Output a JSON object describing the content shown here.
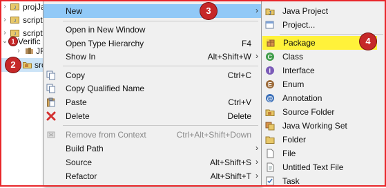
{
  "tree": {
    "rows": [
      {
        "label": "projJa",
        "chevron": "›"
      },
      {
        "label": "script",
        "chevron": "›"
      },
      {
        "label": "script",
        "chevron": "›"
      },
      {
        "label": "Verific",
        "chevron": "⌄"
      },
      {
        "label": "JR",
        "chevron": "›"
      },
      {
        "label": "src",
        "chevron": ""
      }
    ]
  },
  "badges": {
    "one": "1",
    "two": "2",
    "three": "3",
    "four": "4"
  },
  "context_menu": {
    "items": [
      {
        "label": "New",
        "shortcut": "",
        "submenu_arrow": "›",
        "highlighted": true
      },
      {
        "label": "Open in New Window",
        "shortcut": ""
      },
      {
        "label": "Open Type Hierarchy",
        "shortcut": "F4"
      },
      {
        "label": "Show In",
        "shortcut": "Alt+Shift+W",
        "submenu_arrow": "›"
      },
      {
        "label": "Copy",
        "shortcut": "Ctrl+C",
        "icon": "copy-icon"
      },
      {
        "label": "Copy Qualified Name",
        "shortcut": "",
        "icon": "copy-qualified-icon"
      },
      {
        "label": "Paste",
        "shortcut": "Ctrl+V",
        "icon": "paste-icon"
      },
      {
        "label": "Delete",
        "shortcut": "Delete",
        "icon": "delete-icon"
      },
      {
        "label": "Remove from Context",
        "shortcut": "Ctrl+Alt+Shift+Down",
        "disabled": true,
        "icon": "remove-context-icon"
      },
      {
        "label": "Build Path",
        "shortcut": "",
        "submenu_arrow": "›"
      },
      {
        "label": "Source",
        "shortcut": "Alt+Shift+S",
        "submenu_arrow": "›"
      },
      {
        "label": "Refactor",
        "shortcut": "Alt+Shift+T",
        "submenu_arrow": "›"
      }
    ]
  },
  "new_submenu": {
    "items": [
      {
        "label": "Java Project",
        "icon": "java-project-icon"
      },
      {
        "label": "Project...",
        "icon": "project-icon"
      },
      {
        "label": "Package",
        "icon": "package-icon",
        "highlighted": true
      },
      {
        "label": "Class",
        "icon": "class-icon"
      },
      {
        "label": "Interface",
        "icon": "interface-icon"
      },
      {
        "label": "Enum",
        "icon": "enum-icon"
      },
      {
        "label": "Annotation",
        "icon": "annotation-icon"
      },
      {
        "label": "Source Folder",
        "icon": "source-folder-icon"
      },
      {
        "label": "Java Working Set",
        "icon": "working-set-icon"
      },
      {
        "label": "Folder",
        "icon": "folder-icon"
      },
      {
        "label": "File",
        "icon": "file-icon"
      },
      {
        "label": "Untitled Text File",
        "icon": "text-file-icon"
      },
      {
        "label": "Task",
        "icon": "task-icon"
      }
    ]
  },
  "colors": {
    "highlight_yellow": "#fff23a",
    "menu_hover_blue": "#91c9f7",
    "badge_red": "#c62828",
    "frame_red": "#e8262a"
  }
}
